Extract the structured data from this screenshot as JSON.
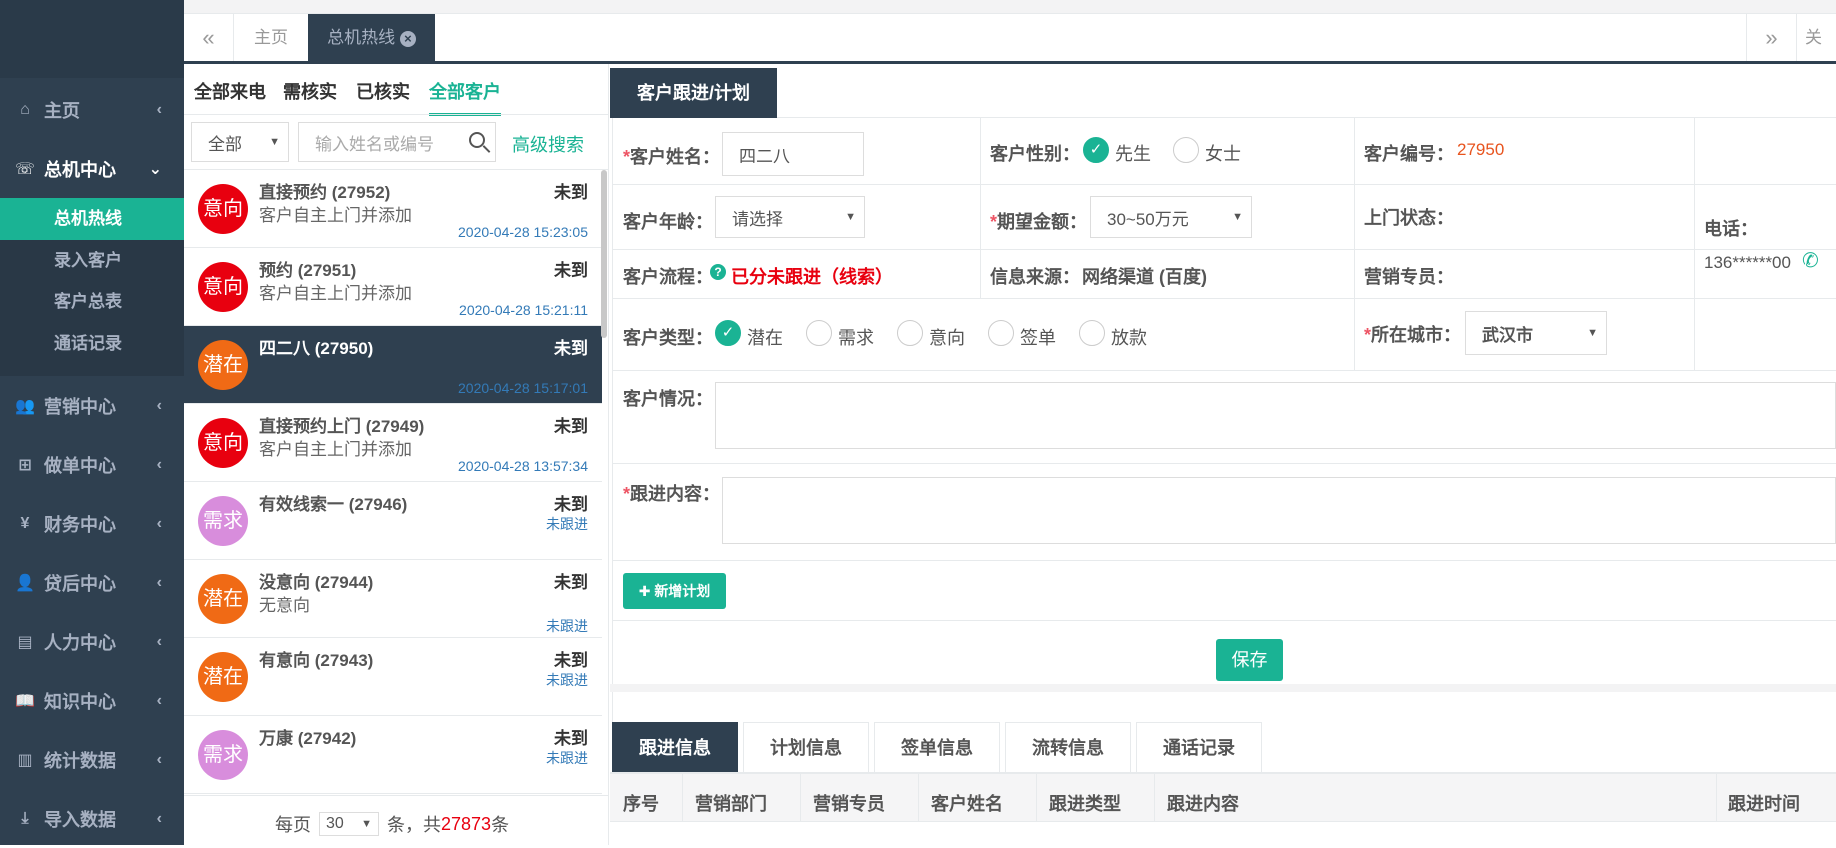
{
  "sidebar": {
    "items": [
      {
        "label": "主页",
        "icon": "home-icon",
        "glyph": "⌂"
      },
      {
        "label": "总机中心",
        "icon": "phone-volume-icon",
        "glyph": "☏"
      },
      {
        "label": "营销中心",
        "icon": "users-icon",
        "glyph": "👥"
      },
      {
        "label": "做单中心",
        "icon": "sitemap-icon",
        "glyph": "⊞"
      },
      {
        "label": "财务中心",
        "icon": "yen-icon",
        "glyph": "¥"
      },
      {
        "label": "贷后中心",
        "icon": "user-plus-icon",
        "glyph": "👤"
      },
      {
        "label": "人力中心",
        "icon": "list-alt-icon",
        "glyph": "▤"
      },
      {
        "label": "知识中心",
        "icon": "book-icon",
        "glyph": "📖"
      },
      {
        "label": "统计数据",
        "icon": "bar-chart-icon",
        "glyph": "▥"
      },
      {
        "label": "导入数据",
        "icon": "download-icon",
        "glyph": "⤓"
      }
    ],
    "sub_items": [
      "总机热线",
      "录入客户",
      "客户总表",
      "通话记录"
    ]
  },
  "tabs": {
    "home": "主页",
    "active": "总机热线",
    "close_right": "关闭"
  },
  "list": {
    "filters": [
      "全部来电",
      "需核实",
      "已核实",
      "全部客户"
    ],
    "select_value": "全部",
    "search_placeholder": "输入姓名或编号",
    "advanced": "高级搜索",
    "items": [
      {
        "badge": "意向",
        "color": "#e8000f",
        "name": "直接预约 (27952)",
        "status": "未到",
        "desc": "客户自主上门并添加",
        "time": "2020-04-28 15:23:05",
        "follow": ""
      },
      {
        "badge": "意向",
        "color": "#e8000f",
        "name": "预约 (27951)",
        "status": "未到",
        "desc": "客户自主上门并添加",
        "time": "2020-04-28 15:21:11",
        "follow": ""
      },
      {
        "badge": "潜在",
        "color": "#f06a15",
        "name": "四二八 (27950)",
        "status": "未到",
        "desc": "",
        "time": "2020-04-28 15:17:01",
        "follow": ""
      },
      {
        "badge": "意向",
        "color": "#e8000f",
        "name": "直接预约上门 (27949)",
        "status": "未到",
        "desc": "客户自主上门并添加",
        "time": "2020-04-28 13:57:34",
        "follow": ""
      },
      {
        "badge": "需求",
        "color": "#d88ddc",
        "name": "有效线索一 (27946)",
        "status": "未到",
        "desc": "",
        "time": "",
        "follow": "未跟进"
      },
      {
        "badge": "潜在",
        "color": "#f06a15",
        "name": "没意向 (27944)",
        "status": "未到",
        "desc": "无意向",
        "time": "",
        "follow": "未跟进"
      },
      {
        "badge": "潜在",
        "color": "#f06a15",
        "name": "有意向 (27943)",
        "status": "未到",
        "desc": "",
        "time": "",
        "follow": "未跟进"
      },
      {
        "badge": "需求",
        "color": "#d88ddc",
        "name": "万康 (27942)",
        "status": "未到",
        "desc": "",
        "time": "",
        "follow": "未跟进"
      }
    ],
    "pager": {
      "prefix": "每页",
      "per_page": "30",
      "mid": "条，共",
      "total": "27873",
      "suffix": "条"
    }
  },
  "form": {
    "tab": "客户跟进/计划",
    "name_label": "客户姓名：",
    "name_value": "四二八",
    "gender_label": "客户性别：",
    "gender_options": [
      "先生",
      "女士"
    ],
    "number_label": "客户编号：",
    "number_value": "27950",
    "age_label": "客户年龄：",
    "age_value": "请选择",
    "amount_label": "期望金额：",
    "amount_value": "30~50万元",
    "visit_label": "上门状态：",
    "phone_label": "电话：",
    "phone_value": "136******00",
    "flow_label": "客户流程：",
    "flow_value": "已分未跟进（线索）",
    "source_label": "信息来源：",
    "source_value": "网络渠道 (百度)",
    "sales_label": "营销专员：",
    "type_label": "客户类型：",
    "type_options": [
      "潜在",
      "需求",
      "意向",
      "签单",
      "放款"
    ],
    "city_label": "所在城市：",
    "city_value": "武汉市",
    "situation_label": "客户情况：",
    "content_label": "跟进内容：",
    "add_plan": "新增计划",
    "save": "保存"
  },
  "bottom": {
    "tabs": [
      "跟进信息",
      "计划信息",
      "签单信息",
      "流转信息",
      "通话记录"
    ],
    "columns": [
      "序号",
      "营销部门",
      "营销专员",
      "客户姓名",
      "跟进类型",
      "跟进内容",
      "跟进时间"
    ]
  },
  "colors": {
    "sidebar": "#2f4050",
    "accent": "#1ab394",
    "red": "#ed5565",
    "link": "#337ab7"
  }
}
